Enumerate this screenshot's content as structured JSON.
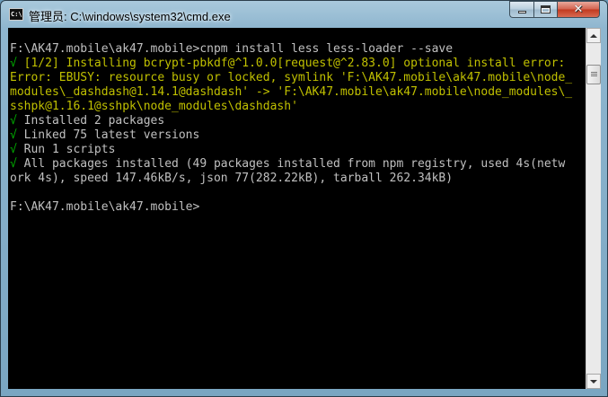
{
  "window": {
    "title": "管理员: C:\\windows\\system32\\cmd.exe",
    "icon": "cmd-icon",
    "controls": {
      "minimize": "minimize-icon",
      "maximize": "maximize-icon",
      "close": "close-icon",
      "close_glyph": "✕"
    }
  },
  "console": {
    "colors": {
      "background": "#000000",
      "text": "#c0c0c0",
      "warning": "#c0c000",
      "success": "#00b000"
    },
    "lines": {
      "l0": "F:\\AK47.mobile\\ak47.mobile>cnpm install less less-loader --save",
      "l1_mark": "√",
      "l1_text": " [1/2] Installing bcrypt-pbkdf@^1.0.0",
      "l1_warn": "[request@^2.83.0] optional install error:",
      "l2": "Error: EBUSY: resource busy or locked, symlink 'F:\\AK47.mobile\\ak47.mobile\\node_",
      "l3": "modules\\_dashdash@1.14.1@dashdash' -> 'F:\\AK47.mobile\\ak47.mobile\\node_modules\\_",
      "l4": "sshpk@1.16.1@sshpk\\node_modules\\dashdash'",
      "l5_mark": "√",
      "l5_text": " Installed 2 packages",
      "l6_mark": "√",
      "l6_text": " Linked 75 latest versions",
      "l7_mark": "√",
      "l7_text": " Run 1 scripts",
      "l8_mark": "√",
      "l8_text": " All packages installed (49 packages installed from npm registry, used 4s(netw",
      "l9": "ork 4s), speed 147.46kB/s, json 77(282.22kB), tarball 262.34kB)",
      "l10": "F:\\AK47.mobile\\ak47.mobile>"
    }
  },
  "scrollbar": {
    "up": "scroll-up-icon",
    "down": "scroll-down-icon"
  }
}
